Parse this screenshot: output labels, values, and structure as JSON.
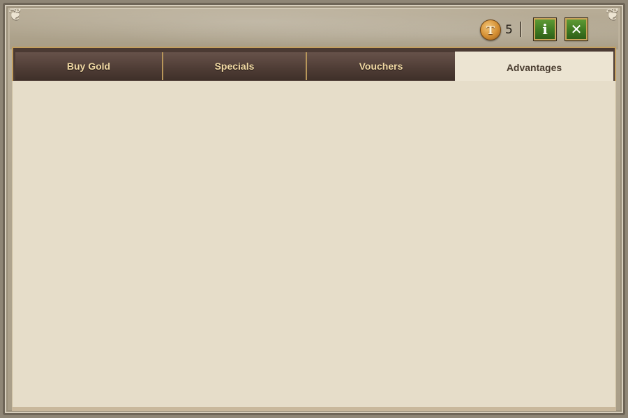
{
  "window": {
    "currency": {
      "icon": "coin-icon",
      "glyph": "T",
      "count": "5"
    },
    "info_button": {
      "icon": "info-icon",
      "glyph": "i"
    },
    "close_button": {
      "icon": "close-icon",
      "glyph": "✕"
    },
    "corners": {
      "glyph": "❦"
    }
  },
  "tabs": [
    {
      "label": "Buy Gold",
      "active": false
    },
    {
      "label": "Specials",
      "active": false
    },
    {
      "label": "Vouchers",
      "active": false
    },
    {
      "label": "Advantages",
      "active": true
    }
  ],
  "colors": {
    "tab_text": "#f1d9a4",
    "active_tab_bg": "#ece4d2",
    "content_bg": "#e6ddc9",
    "button_green": "#3f7a22",
    "coin_gold": "#d48f33"
  }
}
